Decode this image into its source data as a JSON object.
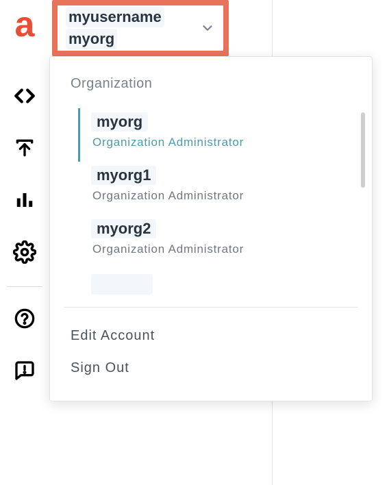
{
  "header": {
    "username": "myusername",
    "org": "myorg"
  },
  "dropdown": {
    "section_title": "Organization",
    "orgs": [
      {
        "name": "myorg",
        "role": "Organization Administrator",
        "selected": true
      },
      {
        "name": "myorg1",
        "role": "Organization Administrator",
        "selected": false
      },
      {
        "name": "myorg2",
        "role": "Organization Administrator",
        "selected": false
      }
    ],
    "actions": {
      "edit_account": "Edit Account",
      "sign_out": "Sign Out"
    }
  }
}
